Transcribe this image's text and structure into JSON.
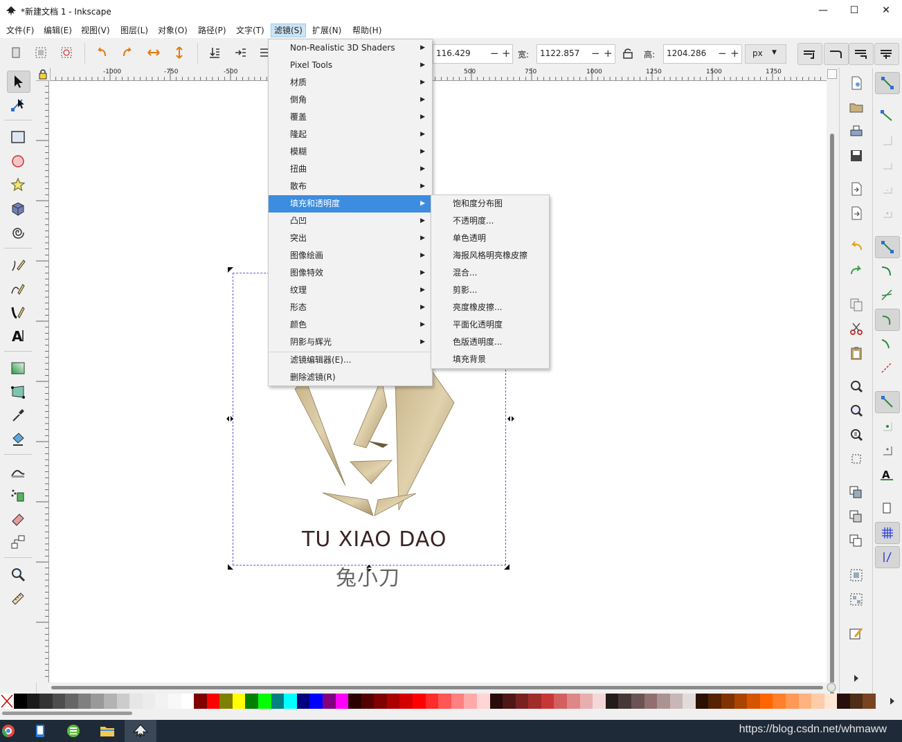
{
  "window": {
    "title": "*新建文档 1 - Inkscape",
    "minimize": "—",
    "maximize": "☐",
    "close": "✕"
  },
  "menubar": {
    "items": [
      {
        "label": "文件(F)"
      },
      {
        "label": "编辑(E)"
      },
      {
        "label": "视图(V)"
      },
      {
        "label": "图层(L)"
      },
      {
        "label": "对象(O)"
      },
      {
        "label": "路径(P)"
      },
      {
        "label": "文字(T)"
      },
      {
        "label": "滤镜(S)"
      },
      {
        "label": "扩展(N)"
      },
      {
        "label": "帮助(H)"
      }
    ],
    "active_index": 7
  },
  "toolbar": {
    "y_value": "116.429",
    "w_label": "宽:",
    "w_value": "1122.857",
    "h_label": "高:",
    "h_value": "1204.286",
    "unit": "px"
  },
  "ruler": {
    "h_ticks": [
      "-1000",
      "-750",
      "-500",
      "500",
      "750",
      "1000",
      "1250",
      "1500",
      "1750"
    ],
    "v_ticks": [
      "250",
      "0",
      "250",
      "500",
      "750",
      "1000",
      "1250",
      "1500",
      "1750"
    ]
  },
  "filters_menu": {
    "items": [
      {
        "label": "Non-Realistic 3D Shaders",
        "submenu": true
      },
      {
        "label": "Pixel Tools",
        "submenu": true
      },
      {
        "label": "材质",
        "submenu": true
      },
      {
        "label": "倒角",
        "submenu": true
      },
      {
        "label": "覆盖",
        "submenu": true
      },
      {
        "label": "隆起",
        "submenu": true
      },
      {
        "label": "模糊",
        "submenu": true
      },
      {
        "label": "扭曲",
        "submenu": true
      },
      {
        "label": "散布",
        "submenu": true
      },
      {
        "label": "填充和透明度",
        "submenu": true,
        "highlighted": true
      },
      {
        "label": "凸凹",
        "submenu": true
      },
      {
        "label": "突出",
        "submenu": true
      },
      {
        "label": "图像绘画",
        "submenu": true
      },
      {
        "label": "图像特效",
        "submenu": true
      },
      {
        "label": "纹理",
        "submenu": true
      },
      {
        "label": "形态",
        "submenu": true
      },
      {
        "label": "颜色",
        "submenu": true
      },
      {
        "label": "阴影与辉光",
        "submenu": true
      }
    ],
    "footer_items": [
      {
        "label": "滤镜编辑器(E)..."
      },
      {
        "label": "删除滤镜(R)"
      }
    ]
  },
  "fill_transparency_submenu": {
    "items": [
      {
        "label": "饱和度分布图"
      },
      {
        "label": "不透明度..."
      },
      {
        "label": "单色透明"
      },
      {
        "label": "海报风格明亮橡皮擦"
      },
      {
        "label": "混合..."
      },
      {
        "label": "剪影..."
      },
      {
        "label": "亮度橡皮擦..."
      },
      {
        "label": "平面化透明度"
      },
      {
        "label": "色版透明度..."
      },
      {
        "label": "填充背景"
      }
    ]
  },
  "canvas": {
    "logo_text_en": "TU XIAO DAO",
    "logo_text_cn": "兔小刀"
  },
  "palette": {
    "colors": [
      "#000000",
      "#1a1a1a",
      "#333333",
      "#4d4d4d",
      "#666666",
      "#808080",
      "#999999",
      "#b3b3b3",
      "#cccccc",
      "#e6e6e6",
      "#ececec",
      "#f2f2f2",
      "#f8f8f8",
      "#ffffff",
      "#800000",
      "#ff0000",
      "#808000",
      "#ffff00",
      "#008000",
      "#00ff00",
      "#008080",
      "#00ffff",
      "#000080",
      "#0000ff",
      "#800080",
      "#ff00ff",
      "#2b0000",
      "#550000",
      "#800000",
      "#aa0000",
      "#d40000",
      "#ff0000",
      "#ff2a2a",
      "#ff5555",
      "#ff8080",
      "#ffaaaa",
      "#ffd5d5",
      "#280b0b",
      "#501616",
      "#782121",
      "#a02c2c",
      "#c83737",
      "#d35f5f",
      "#de8787",
      "#e9afaf",
      "#f4d7d7",
      "#241c1c",
      "#483737",
      "#6c5353",
      "#916f6f",
      "#ac9393",
      "#c8b7b7",
      "#e3dbdb",
      "#2b1100",
      "#552200",
      "#803300",
      "#aa4400",
      "#d45500",
      "#ff6600",
      "#ff7f2a",
      "#ff9955",
      "#ffb380",
      "#ffccaa",
      "#ffe6d5",
      "#280f0b",
      "#502d16",
      "#784421"
    ]
  },
  "taskbar": {
    "watermark": "https://blog.csdn.net/whmaww"
  }
}
